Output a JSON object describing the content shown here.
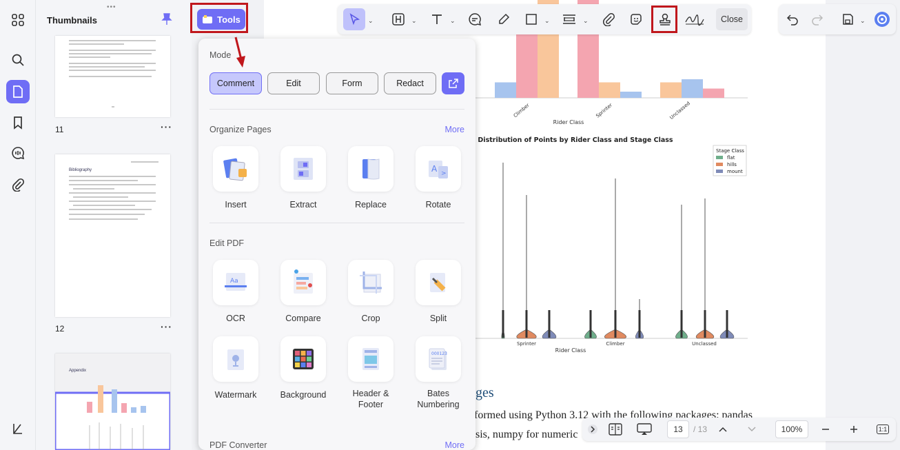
{
  "thumbnails": {
    "title": "Thumbnails",
    "pages": [
      {
        "number": "11"
      },
      {
        "number": "12",
        "heading": "Bibliography"
      },
      {
        "number": "",
        "heading": "Appendix"
      }
    ]
  },
  "tools_button": {
    "label": "Tools"
  },
  "panel": {
    "mode_title": "Mode",
    "modes": [
      "Comment",
      "Edit",
      "Form",
      "Redact"
    ],
    "organize_title": "Organize Pages",
    "organize_more": "More",
    "organize_tools": [
      "Insert",
      "Extract",
      "Replace",
      "Rotate"
    ],
    "edit_title": "Edit PDF",
    "edit_tools": [
      "OCR",
      "Compare",
      "Crop",
      "Split",
      "Watermark",
      "Background",
      "Header & Footer",
      "Bates Numbering"
    ],
    "converter_title": "PDF Converter",
    "converter_more": "More"
  },
  "toolbar": {
    "close_label": "Close"
  },
  "document": {
    "chart1_xlabel": "Rider Class",
    "chart1_ticks": [
      "Climber",
      "Sprinter",
      "Unclassed"
    ],
    "chart2_title": "Distribution of Points by Rider Class and Stage Class",
    "legend_title": "Stage Class",
    "legend_items": [
      "flat",
      "hills",
      "mount"
    ],
    "chart2_ticks": [
      "Sprinter",
      "Climber",
      "Unclassed"
    ],
    "chart2_xlabel": "Rider Class",
    "heading_fragment": "ges",
    "line1": "formed using Python 3.12 with the following packages: pandas",
    "line2": "sis, numpy for numeric"
  },
  "bottom_bar": {
    "page_current": "13",
    "page_total": "/ 13",
    "zoom": "100%",
    "fit_label": "1:1"
  },
  "colors": {
    "accent": "#6f6df5",
    "highlight": "#c0171c",
    "flat": "#6fae8b",
    "hills": "#e08a60",
    "mount": "#7f8bb8"
  },
  "chart_data": [
    {
      "type": "bar",
      "categories": [
        "Climber",
        "Sprinter",
        "Unclassed"
      ],
      "series": [
        {
          "values": [
            0.5,
            3.5,
            0.5
          ]
        },
        {
          "values": [
            2.1,
            0.5,
            0.6
          ]
        },
        {
          "values": [
            4.1,
            0.2,
            0.3
          ]
        }
      ],
      "xlabel": "Rider Class"
    },
    {
      "type": "violin",
      "title": "Distribution of Points by Rider Class and Stage Class",
      "categories": [
        "Sprinter",
        "Climber",
        "Unclassed"
      ],
      "series": [
        {
          "name": "flat"
        },
        {
          "name": "hills"
        },
        {
          "name": "mount"
        }
      ],
      "xlabel": "Rider Class",
      "legend": "top-right"
    }
  ]
}
